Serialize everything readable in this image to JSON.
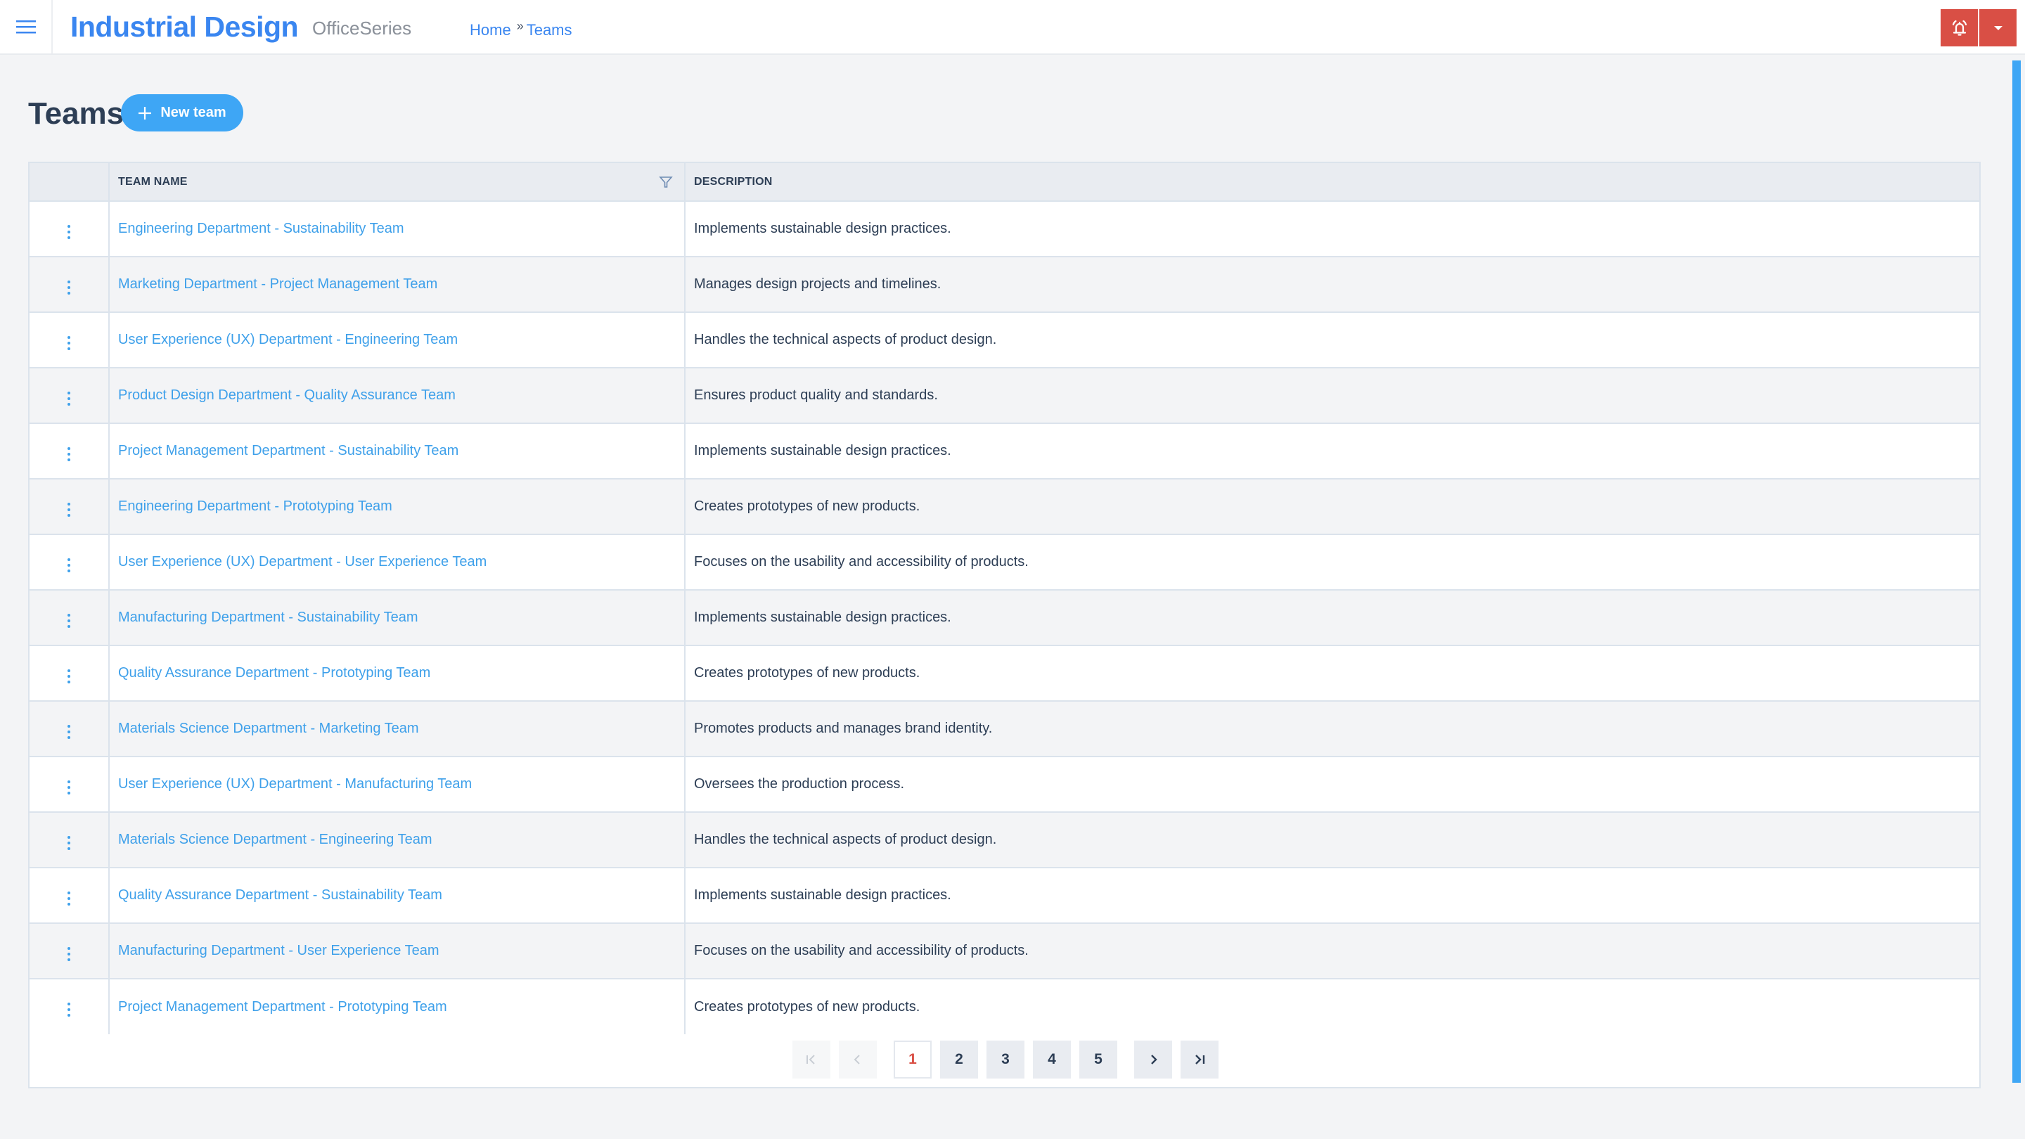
{
  "header": {
    "app_title": "Industrial Design",
    "app_subtitle": "OfficeSeries",
    "breadcrumb": [
      {
        "label": "Home"
      },
      {
        "label": "Teams"
      }
    ],
    "breadcrumb_separator": "»",
    "icons": {
      "menu": "hamburger-menu-icon",
      "alert": "bell-ringing-icon",
      "dropdown": "caret-down-icon"
    },
    "alert_color": "#d94f45"
  },
  "page": {
    "title": "Teams",
    "new_button_label": "New team",
    "accent_color": "#3ea6f5"
  },
  "table": {
    "columns": [
      {
        "key": "actions",
        "label": ""
      },
      {
        "key": "team_name",
        "label": "TEAM NAME",
        "filterable": true
      },
      {
        "key": "description",
        "label": "DESCRIPTION"
      }
    ],
    "rows": [
      {
        "team_name": "Engineering Department - Sustainability Team",
        "description": "Implements sustainable design practices."
      },
      {
        "team_name": "Marketing Department - Project Management Team",
        "description": "Manages design projects and timelines."
      },
      {
        "team_name": "User Experience (UX) Department - Engineering Team",
        "description": "Handles the technical aspects of product design."
      },
      {
        "team_name": "Product Design Department - Quality Assurance Team",
        "description": "Ensures product quality and standards."
      },
      {
        "team_name": "Project Management Department - Sustainability Team",
        "description": "Implements sustainable design practices."
      },
      {
        "team_name": "Engineering Department - Prototyping Team",
        "description": "Creates prototypes of new products."
      },
      {
        "team_name": "User Experience (UX) Department - User Experience Team",
        "description": "Focuses on the usability and accessibility of products."
      },
      {
        "team_name": "Manufacturing Department - Sustainability Team",
        "description": "Implements sustainable design practices."
      },
      {
        "team_name": "Quality Assurance Department - Prototyping Team",
        "description": "Creates prototypes of new products."
      },
      {
        "team_name": "Materials Science Department - Marketing Team",
        "description": "Promotes products and manages brand identity."
      },
      {
        "team_name": "User Experience (UX) Department - Manufacturing Team",
        "description": "Oversees the production process."
      },
      {
        "team_name": "Materials Science Department - Engineering Team",
        "description": "Handles the technical aspects of product design."
      },
      {
        "team_name": "Quality Assurance Department - Sustainability Team",
        "description": "Implements sustainable design practices."
      },
      {
        "team_name": "Manufacturing Department - User Experience Team",
        "description": "Focuses on the usability and accessibility of products."
      },
      {
        "team_name": "Project Management Department - Prototyping Team",
        "description": "Creates prototypes of new products."
      }
    ]
  },
  "pagination": {
    "current_page": 1,
    "pages": [
      "1",
      "2",
      "3",
      "4",
      "5"
    ],
    "first_disabled": true,
    "prev_disabled": true
  }
}
